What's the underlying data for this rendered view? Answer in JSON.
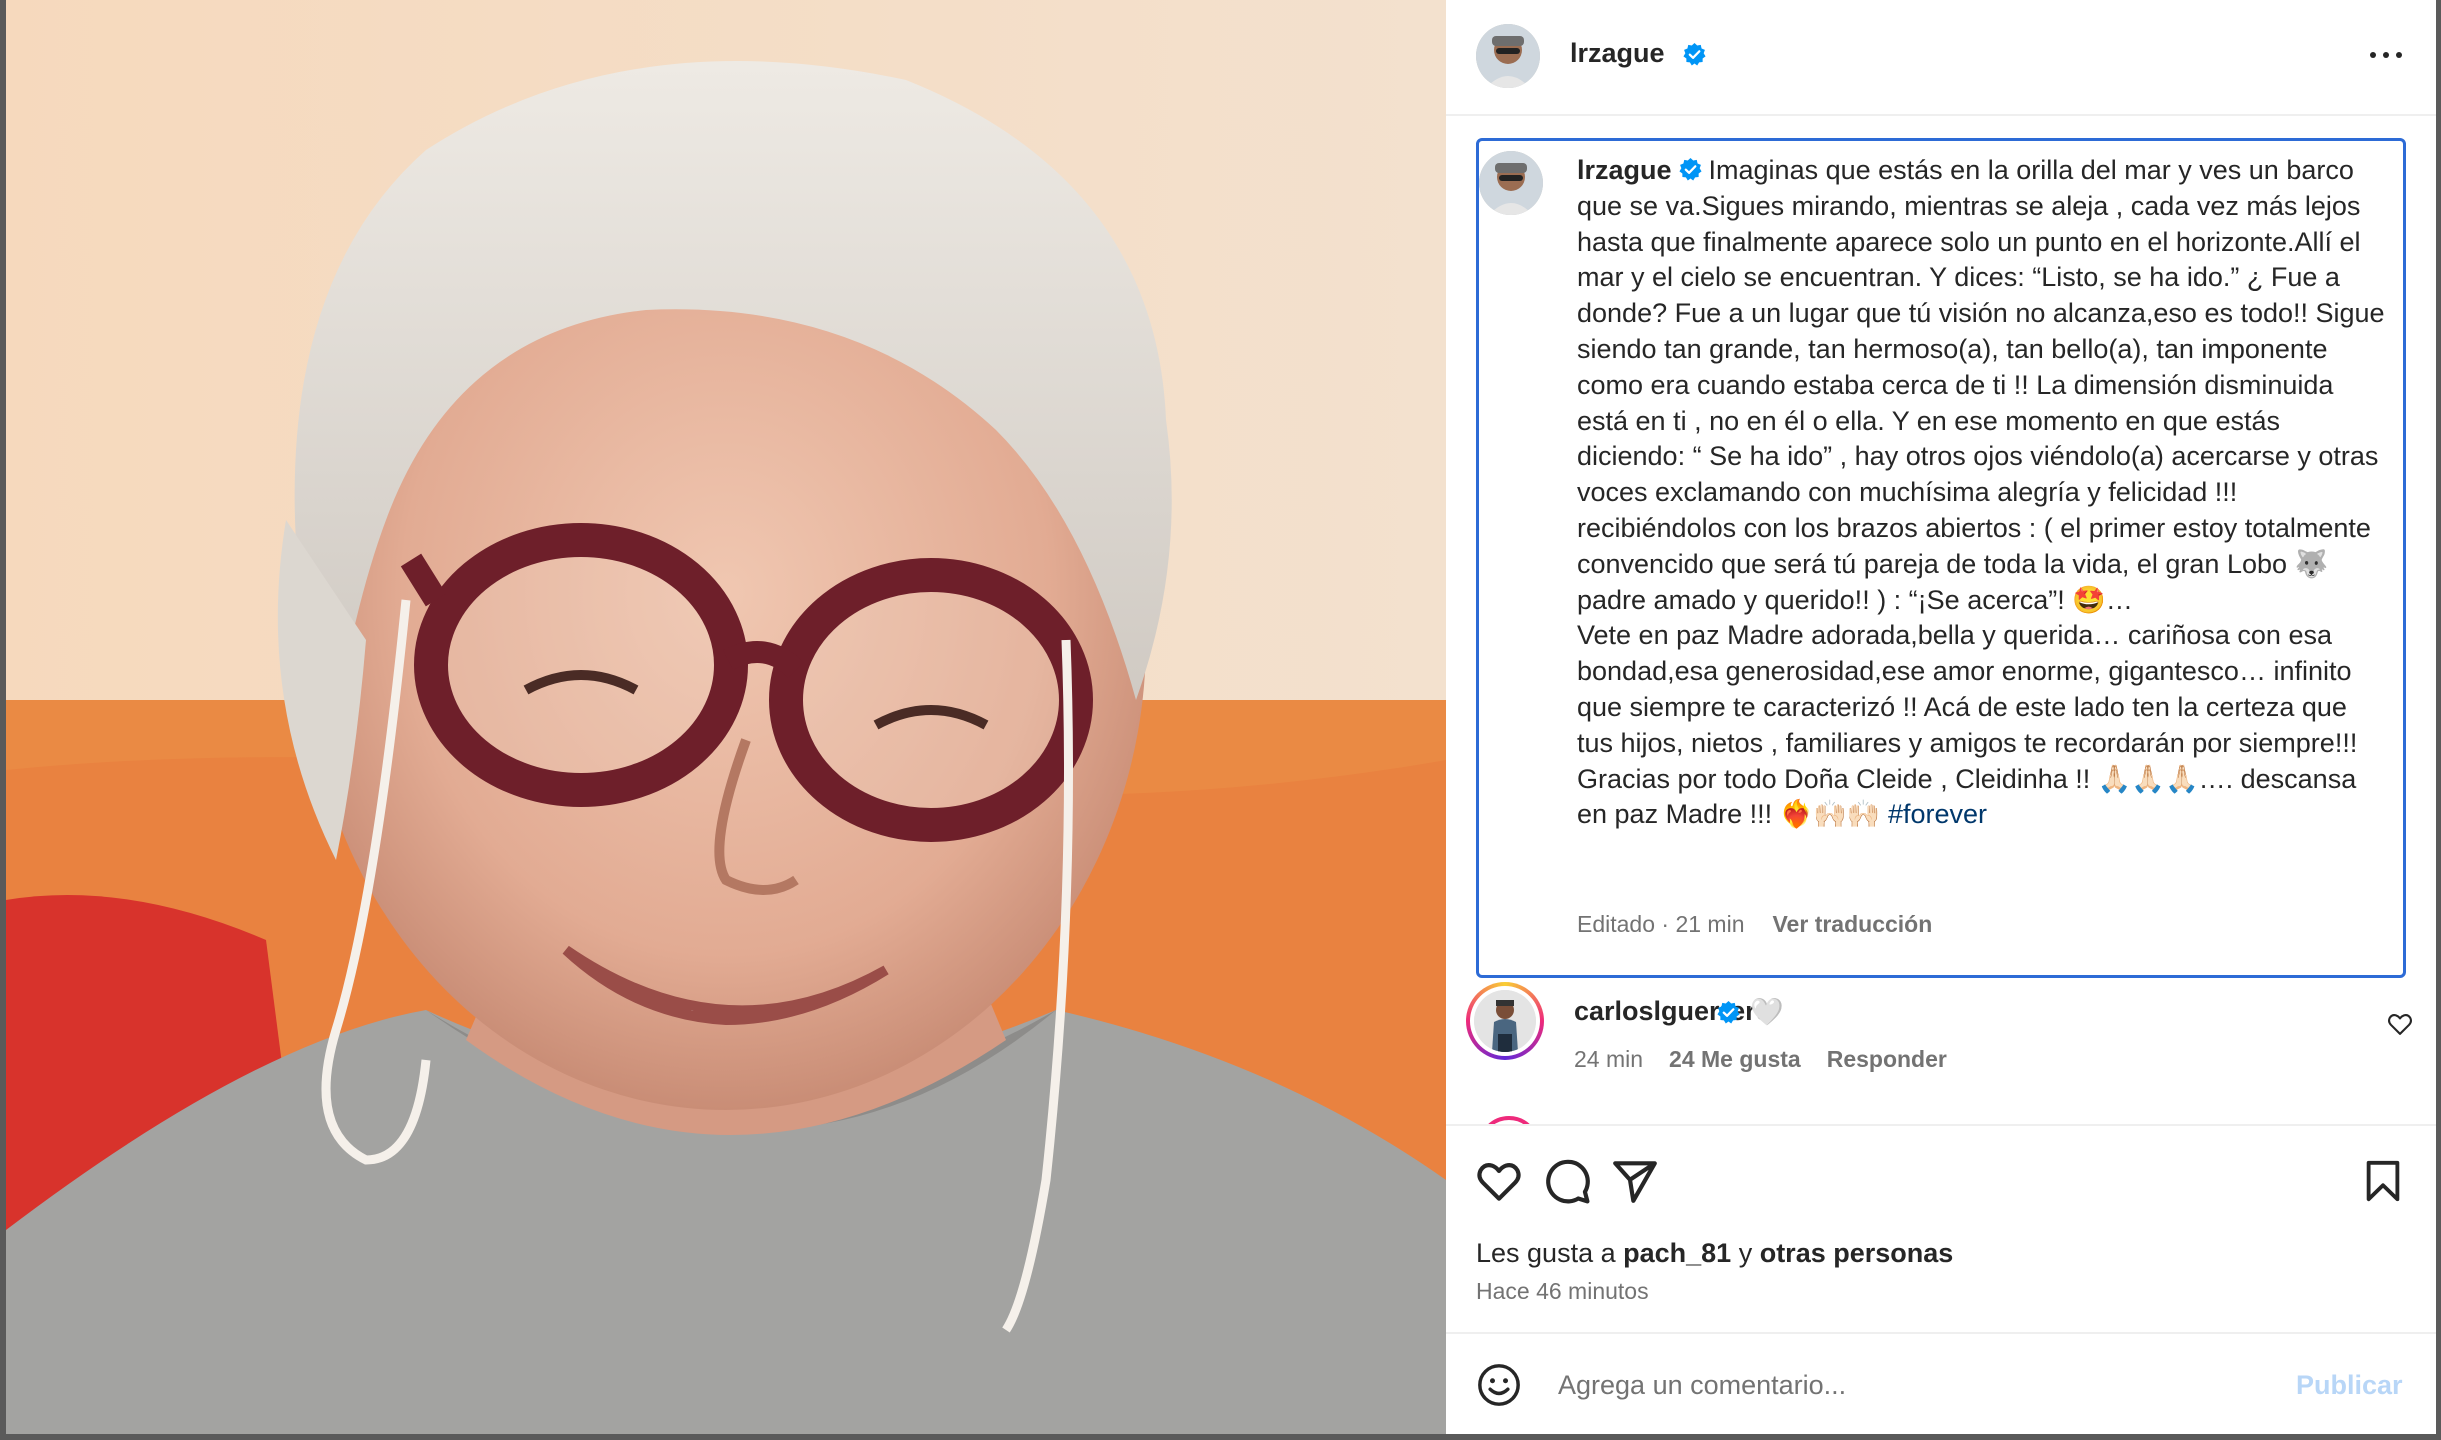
{
  "post": {
    "author": "lrzague",
    "author_verified": true,
    "more_icon": "more-horizontal-icon"
  },
  "caption": {
    "author": "lrzague",
    "text_before_hashtag": "Imaginas que estás en la orilla del mar y ves un barco que se va.Sigues mirando, mientras se aleja , cada vez más lejos hasta que finalmente aparece solo un punto en el horizonte.Allí el mar y el cielo se encuentran. Y dices: “Listo, se ha ido.” ¿ Fue a donde? Fue a un lugar que tú visión no alcanza,eso es todo!! Sigue siendo tan grande, tan hermoso(a), tan bello(a), tan imponente como era cuando estaba cerca de ti !! La dimensión disminuida está en ti , no en él o ella. Y en ese momento en que estás diciendo: “ Se ha ido” , hay otros ojos viéndolo(a) acercarse y otras voces exclamando con muchísima alegría y felicidad !!! recibiéndolos con los brazos abiertos : ( el primer estoy totalmente convencido que será tú pareja de toda la vida, el gran Lobo 🐺 padre amado y querido!! ) : “¡Se acerca”! 🤩…\nVete en paz Madre adorada,bella y querida… cariñosa con esa bondad,esa generosidad,ese amor enorme, gigantesco… infinito que siempre te caracterizó !! Acá de este lado ten la certeza que tus hijos, nietos , familiares y amigos te recordarán por siempre!!!\nGracias por todo Doña Cleide , Cleidinha !! 🙏🏻🙏🏻🙏🏻…. descansa en paz Madre !!! ❤️‍🔥🙌🏻🙌🏻 ",
    "hashtag": "#forever",
    "edited_label": "Editado · 21 min",
    "translate_label": "Ver traducción"
  },
  "comments": [
    {
      "username": "carloslguerrero",
      "verified": true,
      "text": "🤍",
      "time": "24 min",
      "likes": "24 Me gusta",
      "reply_label": "Responder"
    }
  ],
  "actions": {
    "like_icon": "heart-icon",
    "comment_icon": "comment-icon",
    "share_icon": "send-icon",
    "save_icon": "bookmark-icon"
  },
  "likes_line": {
    "prefix": "Les gusta a ",
    "user": "pach_81",
    "connector": " y ",
    "others": "otras personas"
  },
  "time_ago": "Hace 46 minutos",
  "comment_input": {
    "placeholder": "Agrega un comentario...",
    "post_label": "Publicar"
  },
  "colors": {
    "verified_blue": "#0095f6",
    "caption_border": "#2d6bd6",
    "hashtag": "#00376b",
    "post_disabled": "#b8d6f7"
  }
}
